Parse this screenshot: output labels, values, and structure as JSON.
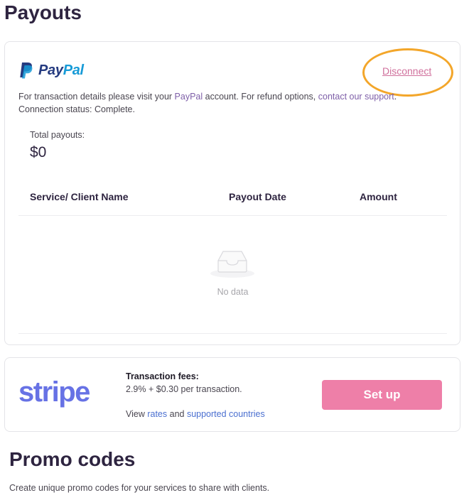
{
  "page": {
    "title": "Payouts"
  },
  "paypal": {
    "logo_text_pay": "Pay",
    "logo_text_pal": "Pal",
    "disconnect_label": "Disconnect",
    "info_prefix": "For transaction details please visit your ",
    "info_paypal_link": "PayPal",
    "info_middle": " account. For refund options, ",
    "info_support_link": "contact our support",
    "info_suffix": ".",
    "connection_status": "Connection status: Complete.",
    "total_label": "Total payouts:",
    "total_value": "$0",
    "table": {
      "columns": [
        "Service/ Client Name",
        "Payout Date",
        "Amount"
      ],
      "rows": [],
      "empty_text": "No data"
    },
    "highlight_color": "#f3a62a"
  },
  "stripe": {
    "logo_text": "stripe",
    "fees_title": "Transaction fees:",
    "fees_value": "2.9% + $0.30 per transaction.",
    "view_prefix": "View ",
    "rates_link": "rates",
    "and_text": " and ",
    "countries_link": "supported countries",
    "setup_label": "Set up",
    "brand_color": "#6772e5"
  },
  "promo": {
    "title": "Promo codes",
    "description": "Create unique promo codes for your services to share with clients."
  }
}
